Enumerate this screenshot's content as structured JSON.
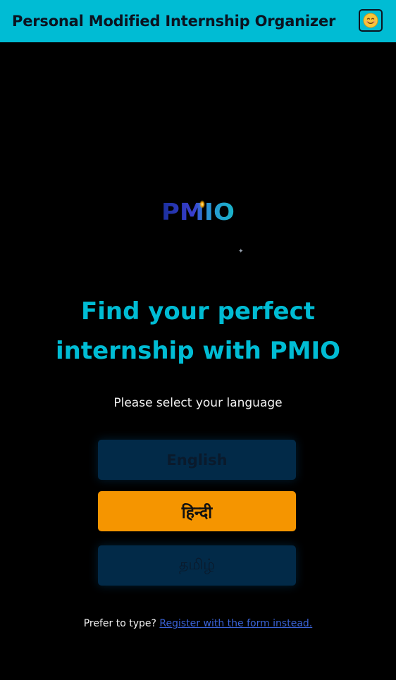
{
  "header": {
    "title": "Personal Modified Internship Organizer",
    "avatar_icon": "smiley-face-icon"
  },
  "logo": {
    "text": "PMIO"
  },
  "hero": {
    "title": "Find your perfect internship with PMIO"
  },
  "language": {
    "prompt": "Please select your language",
    "options": [
      {
        "label": "English",
        "state": "dim"
      },
      {
        "label": "हिन्दी",
        "state": "selected"
      },
      {
        "label": "தமிழ்",
        "state": "dim"
      }
    ]
  },
  "footer": {
    "prefix": "Prefer to type?",
    "link_label": "Register with the form instead."
  },
  "colors": {
    "accent": "#00bcd4",
    "selected": "#f59500",
    "dim_button": "#022a48",
    "link": "#3a63d8",
    "background": "#000000"
  }
}
